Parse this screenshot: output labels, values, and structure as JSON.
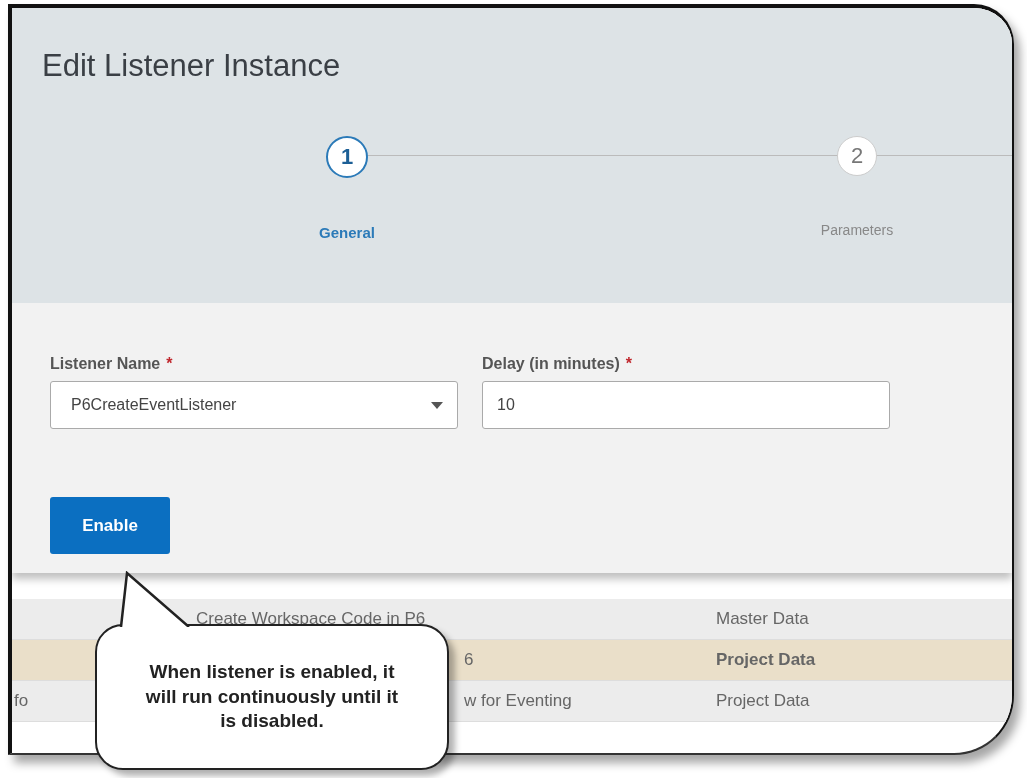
{
  "dialog": {
    "title": "Edit Listener Instance",
    "steps": [
      {
        "number": "1",
        "label": "General",
        "selected": true
      },
      {
        "number": "2",
        "label": "Parameters",
        "selected": false
      }
    ],
    "fields": [
      {
        "label": "Listener Name",
        "required": "*",
        "kind": "dropdown",
        "value": "P6CreateEventListener"
      },
      {
        "label": "Delay (in minutes)",
        "required": "*",
        "kind": "text",
        "value": "10"
      }
    ],
    "button": "Enable"
  },
  "table": {
    "rows": [
      {
        "column_2": "Create Workspace Code in P6",
        "covered": false,
        "column_3": "Master Data",
        "selected": false
      },
      {
        "column_2": "6",
        "covered": true,
        "column_3": "Project Data",
        "selected": true
      },
      {
        "column_1": "fo",
        "column_2": "w for Eventing",
        "covered": true,
        "column_3": "Project Data",
        "selected": false
      }
    ]
  },
  "callout": "When listener is enabled, it will run continuously until it is disabled."
}
